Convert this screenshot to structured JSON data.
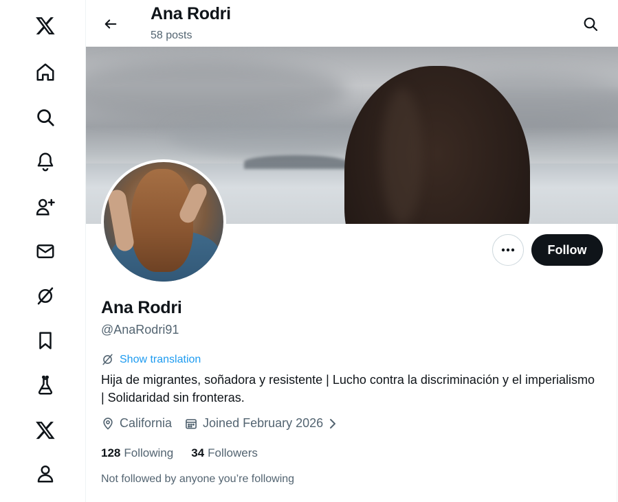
{
  "nav": {
    "items": [
      {
        "name": "x-logo-icon"
      },
      {
        "name": "home-icon"
      },
      {
        "name": "search-icon"
      },
      {
        "name": "notifications-bell-icon"
      },
      {
        "name": "follow-people-icon"
      },
      {
        "name": "messages-envelope-icon"
      },
      {
        "name": "grok-slash-icon"
      },
      {
        "name": "bookmarks-icon"
      },
      {
        "name": "labs-flask-icon"
      },
      {
        "name": "premium-x-icon"
      },
      {
        "name": "profile-person-icon"
      }
    ]
  },
  "header": {
    "title": "Ana Rodri",
    "post_count": "58 posts"
  },
  "profile": {
    "display_name": "Ana Rodri",
    "handle": "@AnaRodri91",
    "show_translation": "Show translation",
    "bio": "Hija de migrantes, soñadora y resistente | Lucho contra la discriminación y el imperialismo | Solidaridad sin fronteras.",
    "location": "California",
    "joined": "Joined February 2026",
    "following_count": "128",
    "following_label": "Following",
    "followers_count": "34",
    "followers_label": "Followers",
    "mutuals_text": "Not followed by anyone you’re following"
  },
  "actions": {
    "follow_label": "Follow"
  },
  "colors": {
    "accent": "#1d9bf0",
    "text": "#0f1419",
    "muted": "#536471",
    "follow_bg": "#0f1419"
  }
}
